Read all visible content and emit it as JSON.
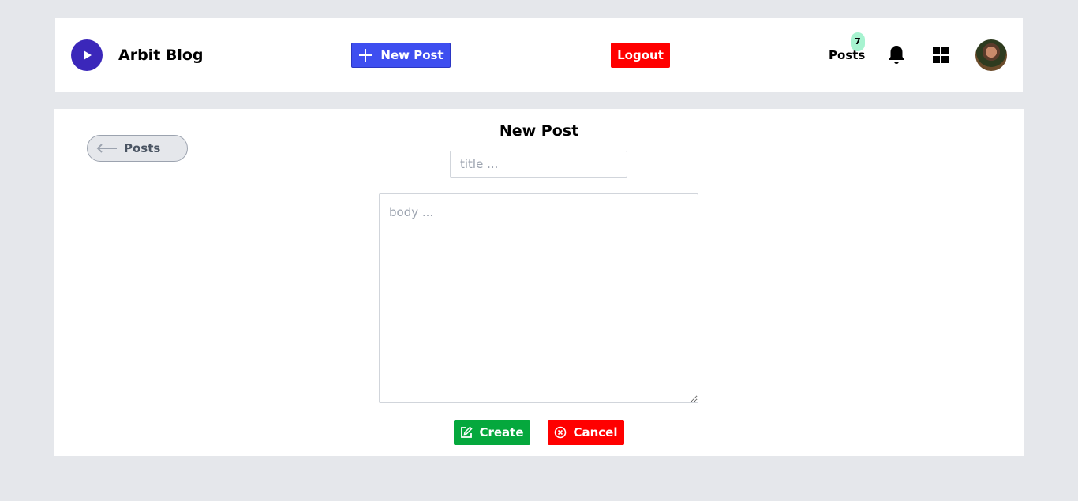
{
  "header": {
    "app_title": "Arbit Blog",
    "logo_icon": "play-icon",
    "new_post_label": "New Post",
    "logout_label": "Logout",
    "posts_label": "Posts",
    "posts_count": "7",
    "notifications_icon": "bell-icon",
    "apps_icon": "grid-icon"
  },
  "form": {
    "back_label": "Posts",
    "heading": "New Post",
    "title_placeholder": "title ...",
    "title_value": "",
    "body_placeholder": "body ...",
    "body_value": "",
    "create_label": "Create",
    "cancel_label": "Cancel"
  },
  "colors": {
    "primary": "#3e4ef0",
    "logo": "#3b27ba",
    "danger": "#ff0000",
    "success": "#05a83d",
    "badge": "#a7f3d0",
    "page_bg": "#e5e7eb"
  }
}
